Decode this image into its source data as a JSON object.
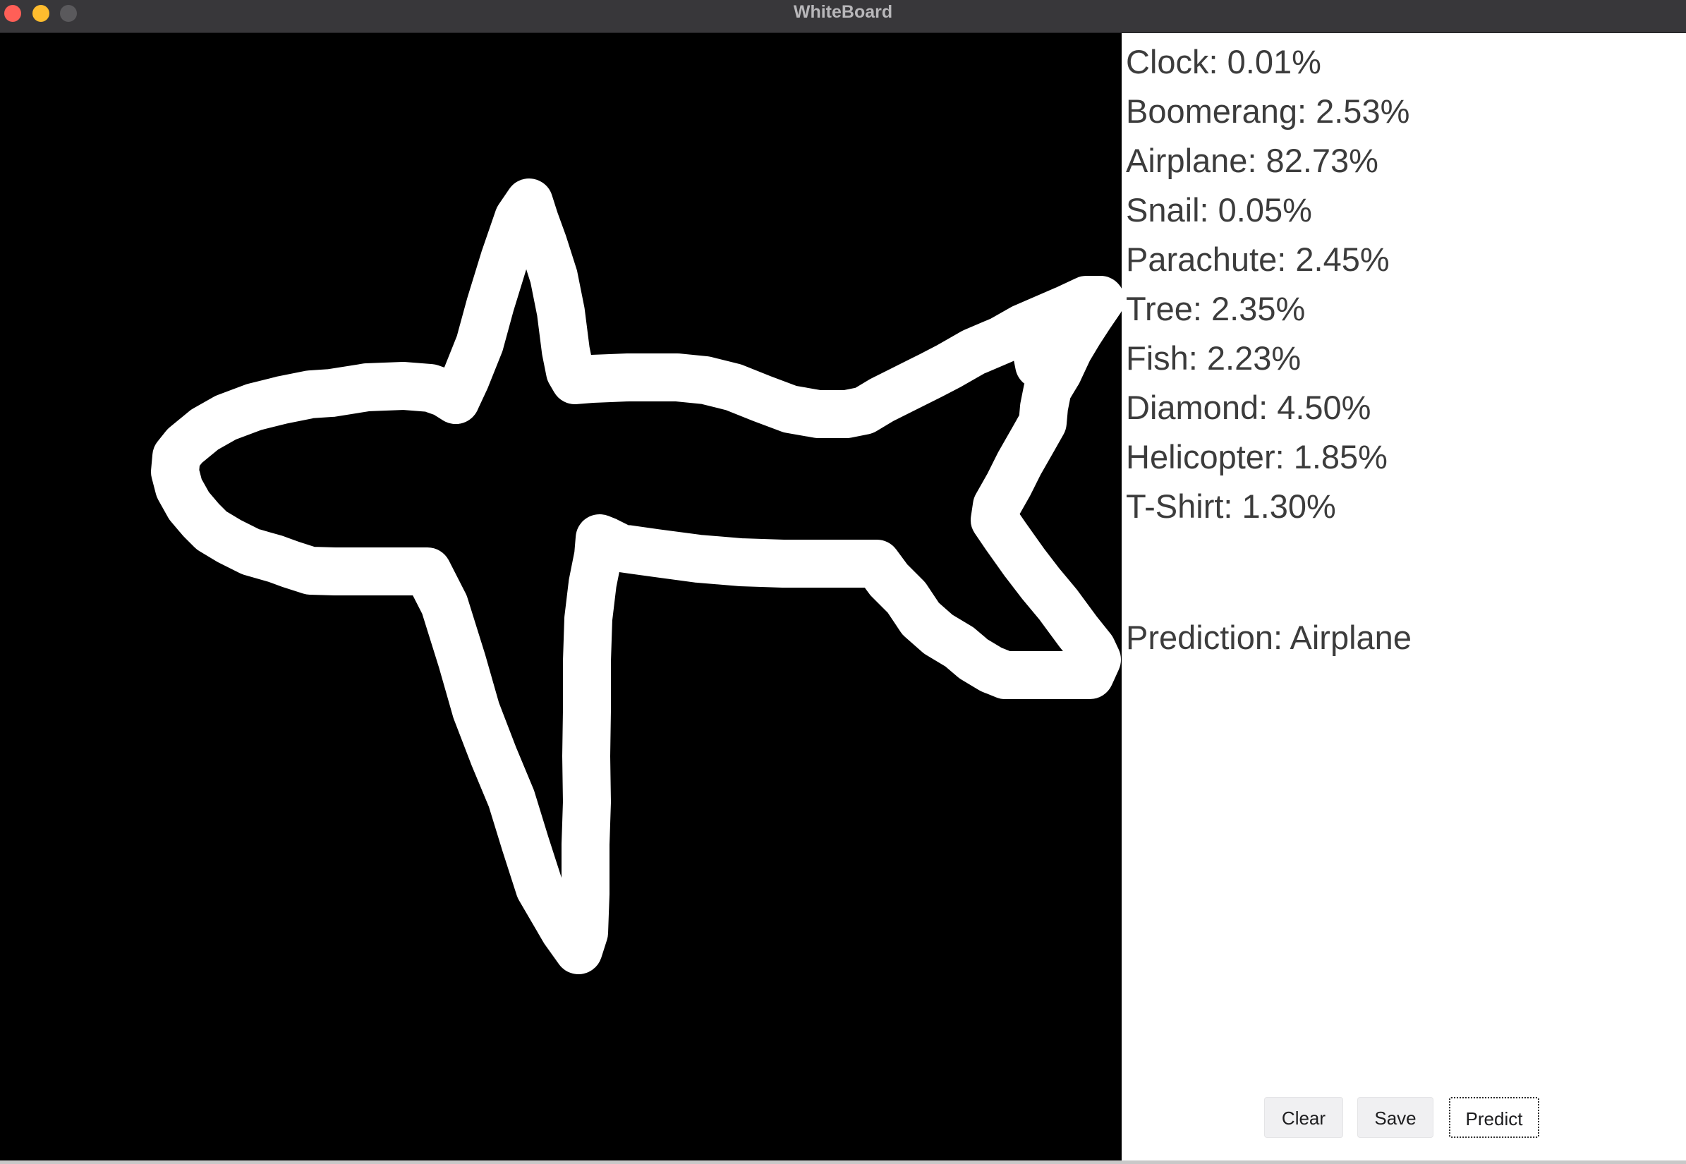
{
  "window": {
    "title": "WhiteBoard"
  },
  "probabilities": [
    {
      "label": "Clock: 0.01%"
    },
    {
      "label": "Boomerang: 2.53%"
    },
    {
      "label": "Airplane: 82.73%"
    },
    {
      "label": "Snail: 0.05%"
    },
    {
      "label": "Parachute: 2.45%"
    },
    {
      "label": "Tree: 2.35%"
    },
    {
      "label": "Fish: 2.23%"
    },
    {
      "label": "Diamond: 4.50%"
    },
    {
      "label": "Helicopter: 1.85%"
    },
    {
      "label": "T-Shirt: 1.30%"
    }
  ],
  "prediction": "Prediction: Airplane",
  "buttons": {
    "clear": "Clear",
    "save": "Save",
    "predict": "Predict"
  },
  "colors": {
    "canvas_background": "#000000",
    "stroke": "#ffffff",
    "titlebar": "#38373a",
    "close": "#ff5f57",
    "minimize": "#febc2e"
  }
}
